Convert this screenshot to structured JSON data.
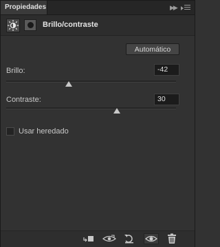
{
  "tab": {
    "label": "Propiedades"
  },
  "header": {
    "title": "Brillo/contraste"
  },
  "auto_button": {
    "label": "Automático"
  },
  "brightness": {
    "label": "Brillo:",
    "value": "-42",
    "slider_fraction": 0.37
  },
  "contrast": {
    "label": "Contraste:",
    "value": "30",
    "slider_fraction": 0.65
  },
  "legacy": {
    "label": "Usar heredado",
    "checked": false
  },
  "footer_icons": [
    "clip-to-layer-icon",
    "view-previous-state-icon",
    "reset-icon",
    "toggle-visibility-icon",
    "delete-icon"
  ]
}
